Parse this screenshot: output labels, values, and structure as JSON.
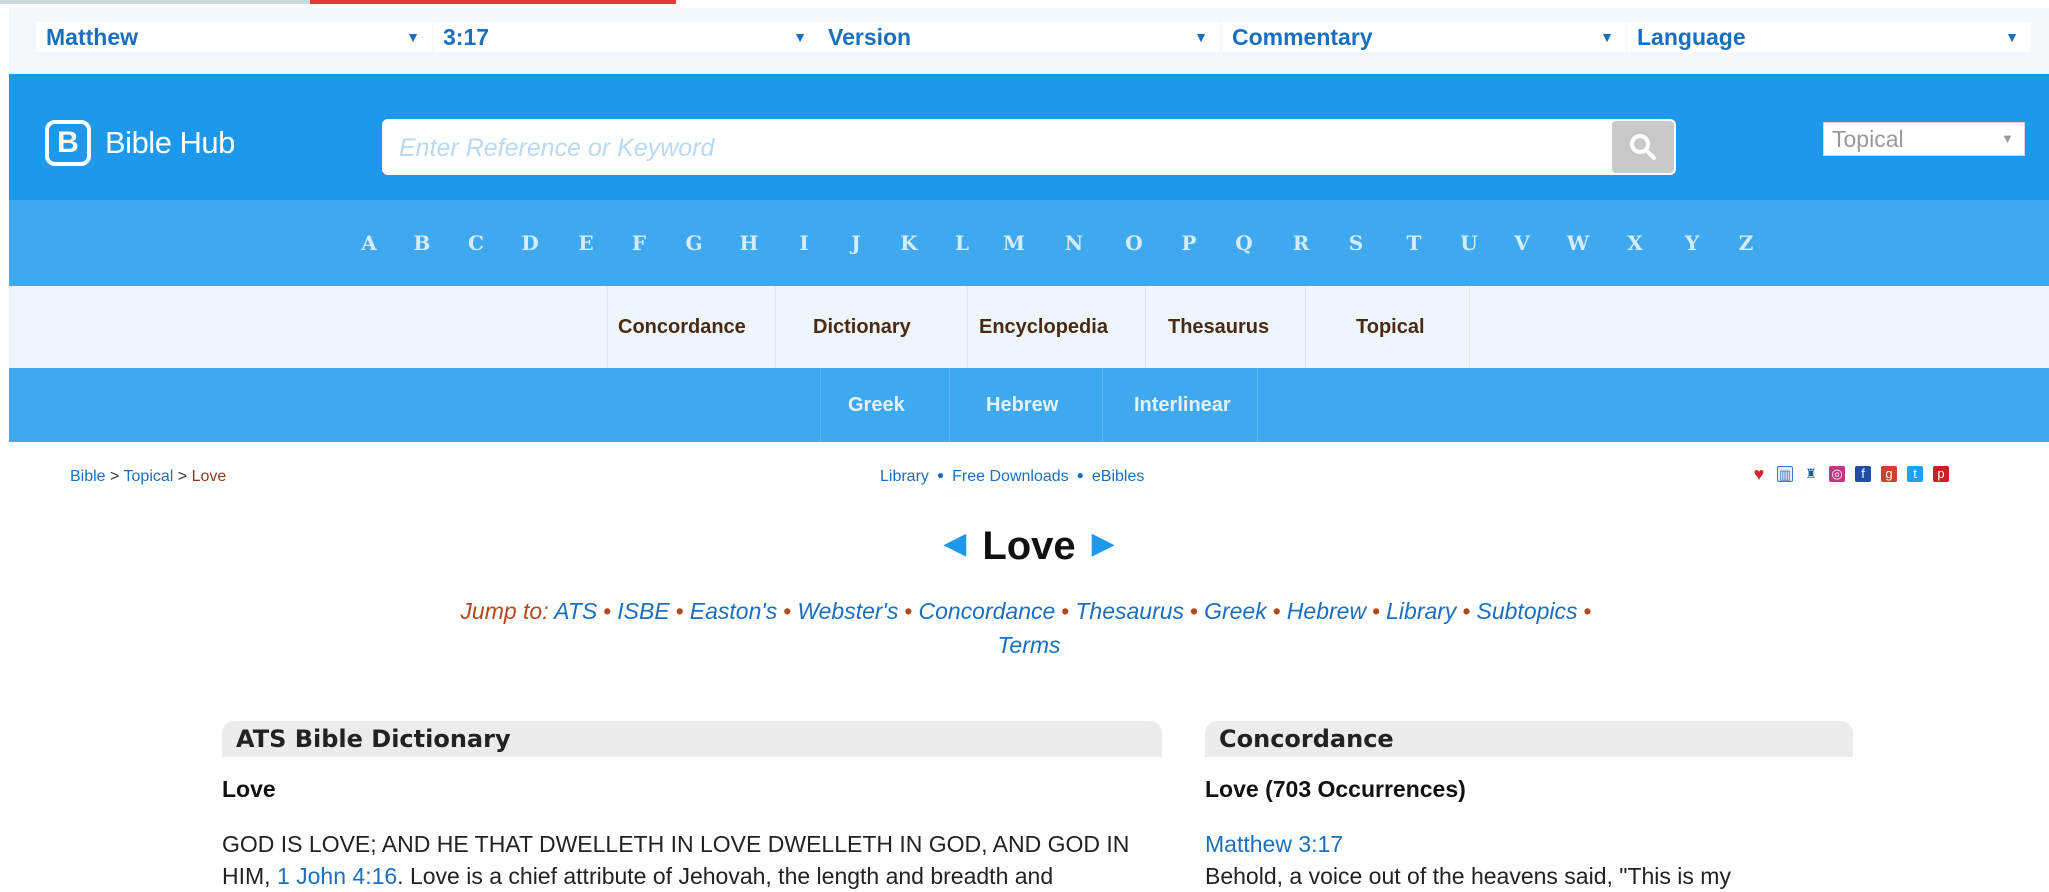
{
  "selectors": [
    {
      "label": "Matthew"
    },
    {
      "label": "3:17"
    },
    {
      "label": "Version"
    },
    {
      "label": "Commentary"
    },
    {
      "label": "Language"
    }
  ],
  "header": {
    "logo_text": "Bible Hub",
    "search_placeholder": "Enter Reference or Keyword",
    "topical_select": "Topical"
  },
  "alphabet": [
    "A",
    "B",
    "C",
    "D",
    "E",
    "F",
    "G",
    "H",
    "I",
    "J",
    "K",
    "L",
    "M",
    "N",
    "O",
    "P",
    "Q",
    "R",
    "S",
    "T",
    "U",
    "V",
    "W",
    "X",
    "Y",
    "Z"
  ],
  "menu": [
    "Concordance",
    "Dictionary",
    "Encyclopedia",
    "Thesaurus",
    "Topical"
  ],
  "menu2": [
    "Greek",
    "Hebrew",
    "Interlinear"
  ],
  "breadcrumb": {
    "bible": "Bible",
    "topical": "Topical",
    "current": "Love",
    "sep": ">"
  },
  "links": [
    "Library",
    "Free Downloads",
    "eBibles"
  ],
  "colors": {
    "brand_blue": "#1e98eb",
    "light_blue": "#3fa9f0",
    "link": "#1a6fc0",
    "accent_brown": "#b4471b"
  },
  "title": "Love",
  "jump": {
    "label": "Jump to:",
    "links": [
      "ATS",
      "ISBE",
      "Easton's",
      "Webster's",
      "Concordance",
      "Thesaurus",
      "Greek",
      "Hebrew",
      "Library",
      "Subtopics",
      "Terms"
    ]
  },
  "left_column": {
    "heading": "ATS Bible Dictionary",
    "subheading": "Love",
    "line1": "GOD IS LOVE; AND HE THAT DWELLETH IN LOVE DWELLETH IN GOD, AND GOD IN",
    "line2_prefix": "HIM,",
    "line2_link": "1 John 4:16",
    "line2_suffix": ". Love is a chief attribute of Jehovah, the length and breadth and"
  },
  "right_column": {
    "heading": "Concordance",
    "subheading": "Love (703 Occurrences)",
    "ref_link": "Matthew 3:17",
    "snippet": "Behold, a voice out of the heavens said, \"This is my"
  }
}
